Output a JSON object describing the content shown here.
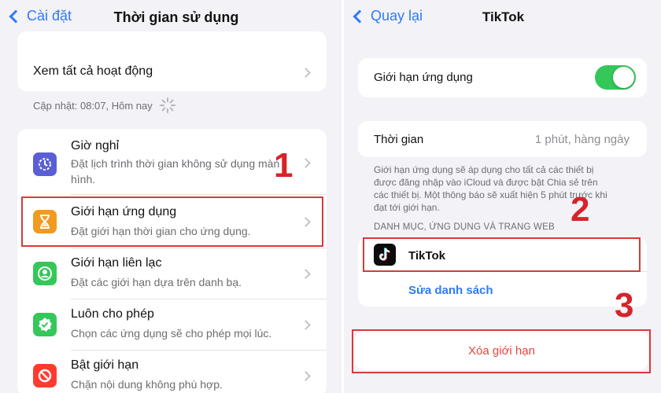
{
  "left": {
    "nav": {
      "back_label": "Cài đặt",
      "title": "Thời gian sử dụng"
    },
    "see_all": "Xem tất cả hoạt động",
    "updated": "Cập nhật: 08:07, Hôm nay",
    "items": [
      {
        "title": "Giờ nghỉ",
        "subtitle": "Đặt lịch trình thời gian không sử dụng màn hình.",
        "icon": "downtime-icon",
        "color": "#5b5fd6"
      },
      {
        "title": "Giới hạn ứng dụng",
        "subtitle": "Đặt giới hạn thời gian cho ứng dụng.",
        "icon": "hourglass-icon",
        "color": "#f29a1f"
      },
      {
        "title": "Giới hạn liên lạc",
        "subtitle": "Đặt các giới hạn dựa trên danh bạ.",
        "icon": "contact-icon",
        "color": "#34c759"
      },
      {
        "title": "Luôn cho phép",
        "subtitle": "Chọn các ứng dụng sẽ cho phép mọi lúc.",
        "icon": "checkmark-badge-icon",
        "color": "#34c759"
      },
      {
        "title": "Bật giới hạn",
        "subtitle": "Chặn nội dung không phù hợp.",
        "icon": "restriction-icon",
        "color": "#ff3b30"
      }
    ],
    "step_number": "1"
  },
  "right": {
    "nav": {
      "back_label": "Quay lại",
      "title": "TikTok"
    },
    "limit_toggle": {
      "label": "Giới hạn ứng dụng",
      "on": true,
      "color": "#34c759"
    },
    "time": {
      "label": "Thời gian",
      "value": "1 phút, hàng ngày"
    },
    "note": "Giới hạn ứng dụng sẽ áp dụng cho tất cả các thiết bị được đăng nhập vào iCloud và được bật Chia sẻ trên các thiết bị. Một thông báo sẽ xuất hiện 5 phút trước khi đạt tới giới hạn.",
    "section_header": "DANH MỤC, ỨNG DỤNG VÀ TRANG WEB",
    "app": {
      "name": "TikTok",
      "icon": "tiktok-icon"
    },
    "edit_list": "Sửa danh sách",
    "delete_limit": "Xóa giới hạn",
    "step_two": "2",
    "step_three": "3"
  },
  "colors": {
    "accent": "#2f7bf5",
    "red": "#d8232a",
    "delete_text": "#e5453a"
  }
}
